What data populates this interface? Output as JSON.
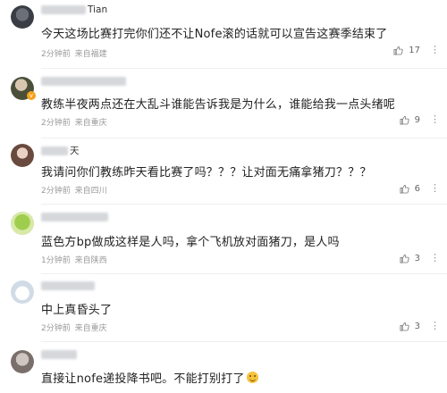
{
  "colors": {
    "text": "#222222",
    "meta": "#999999",
    "badge": "#f7a21b"
  },
  "comments": [
    {
      "username": "",
      "name_suffix": "Tian",
      "text": "今天这场比赛打完你们还不让Nofe滚的话就可以宣告这赛季结束了",
      "time": "2分钟前",
      "location": "来自福建",
      "likes": "17",
      "avatar_icon": "user-avatar"
    },
    {
      "username": "",
      "name_suffix": "",
      "text": "教练半夜两点还在大乱斗谁能告诉我是为什么，谁能给我一点头绪呢",
      "time": "2分钟前",
      "location": "来自重庆",
      "likes": "9",
      "avatar_icon": "user-avatar"
    },
    {
      "username": "",
      "name_suffix": "天",
      "text": "我请问你们教练昨天看比赛了吗？？？让对面无痛拿猪刀？？？",
      "time": "2分钟前",
      "location": "来自四川",
      "likes": "6",
      "avatar_icon": "user-avatar"
    },
    {
      "username": "",
      "name_suffix": "",
      "text": "蓝色方bp做成这样是人吗，拿个飞机放对面猪刀，是人吗",
      "time": "1分钟前",
      "location": "来自陕西",
      "likes": "3",
      "avatar_icon": "user-avatar"
    },
    {
      "username": "",
      "name_suffix": "",
      "text": "中上真昏头了",
      "time": "2分钟前",
      "location": "来自重庆",
      "likes": "3",
      "avatar_icon": "user-avatar"
    },
    {
      "username": "",
      "name_suffix": "",
      "text": "直接让nofe递投降书吧。不能打别打了",
      "time": "",
      "location": "",
      "likes": "",
      "avatar_icon": "user-avatar"
    }
  ],
  "icons": {
    "like": "thumbs-up-icon",
    "more": "more-options-icon",
    "emoji": "smile-emoji-icon"
  }
}
